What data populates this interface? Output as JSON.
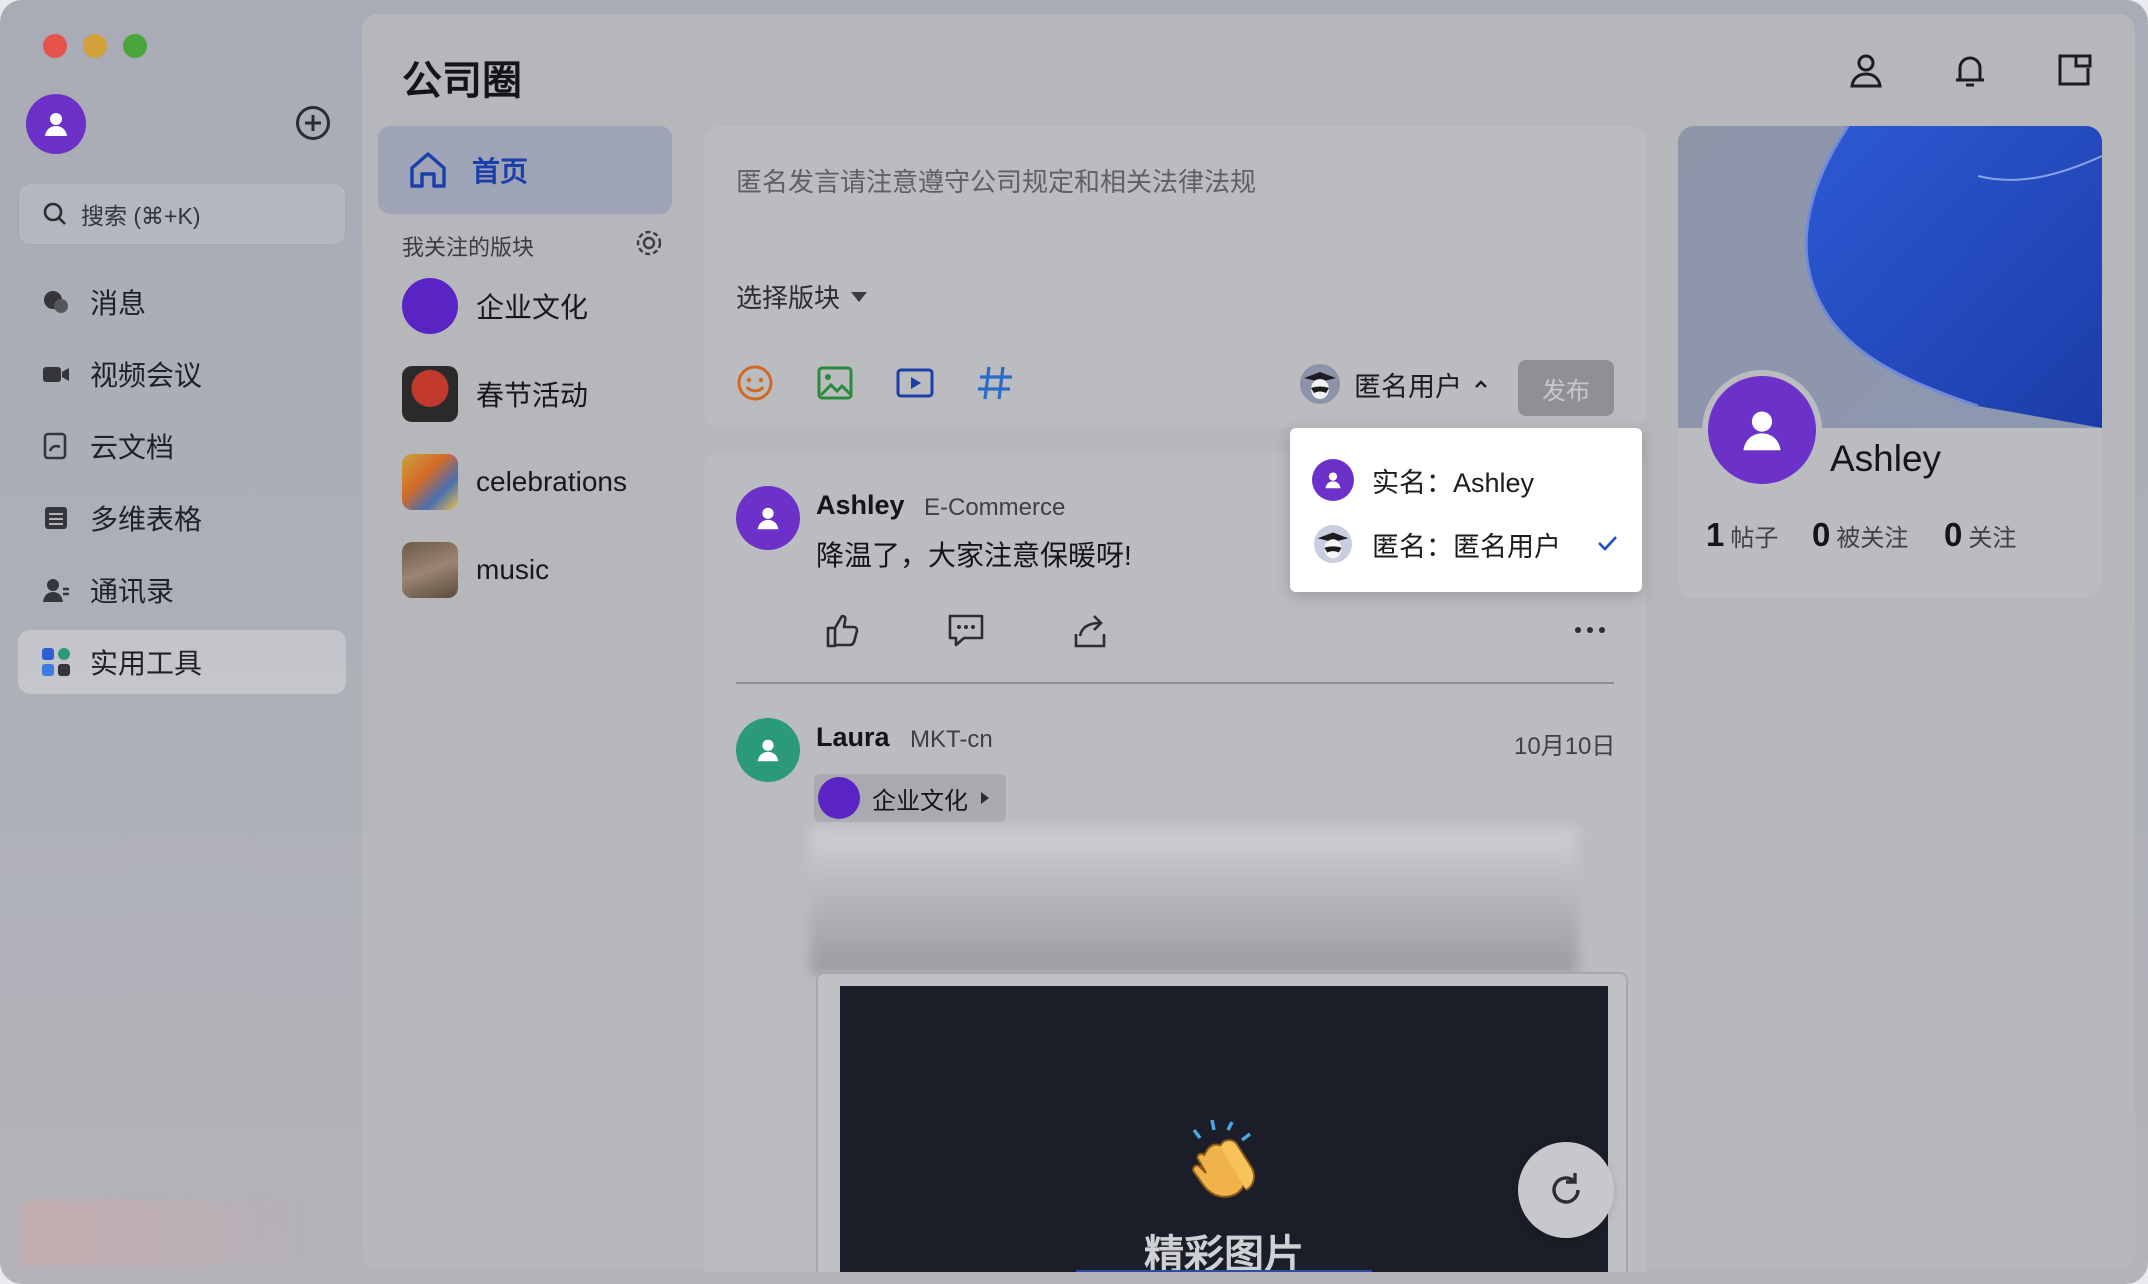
{
  "sidebar": {
    "search_placeholder": "搜索 (⌘+K)",
    "items": [
      {
        "label": "消息",
        "icon": "chat-bubbles-icon"
      },
      {
        "label": "视频会议",
        "icon": "video-camera-icon"
      },
      {
        "label": "云文档",
        "icon": "cloud-doc-icon"
      },
      {
        "label": "多维表格",
        "icon": "table-icon"
      },
      {
        "label": "通讯录",
        "icon": "contacts-icon"
      },
      {
        "label": "实用工具",
        "icon": "tools-icon",
        "active": true
      }
    ]
  },
  "header": {
    "title": "公司圈"
  },
  "sections": {
    "home_label": "首页",
    "followed_label": "我关注的版块",
    "items": [
      {
        "label": "企业文化"
      },
      {
        "label": "春节活动"
      },
      {
        "label": "celebrations"
      },
      {
        "label": "music"
      }
    ]
  },
  "composer": {
    "placeholder": "匿名发言请注意遵守公司规定和相关法律法规",
    "select_section": "选择版块",
    "identity": "匿名用户",
    "publish": "发布"
  },
  "identity_menu": {
    "real_label": "实名：",
    "real_name": "Ashley",
    "anon_label": "匿名：",
    "anon_name": "匿名用户"
  },
  "feed": {
    "posts": [
      {
        "author": "Ashley",
        "dept": "E-Commerce",
        "text": "降温了，大家注意保暖呀!"
      },
      {
        "author": "Laura",
        "dept": "MKT-cn",
        "date": "10月10日",
        "tag": "企业文化",
        "media_caption": "精彩图片"
      }
    ]
  },
  "profile": {
    "name": "Ashley",
    "posts_count": "1",
    "posts_label": "帖子",
    "followers_count": "0",
    "followers_label": "被关注",
    "following_count": "0",
    "following_label": "关注"
  },
  "colors": {
    "accent": "#1a3fa8",
    "avatar_purple": "#6b31c8",
    "avatar_green": "#2a9a7a"
  }
}
